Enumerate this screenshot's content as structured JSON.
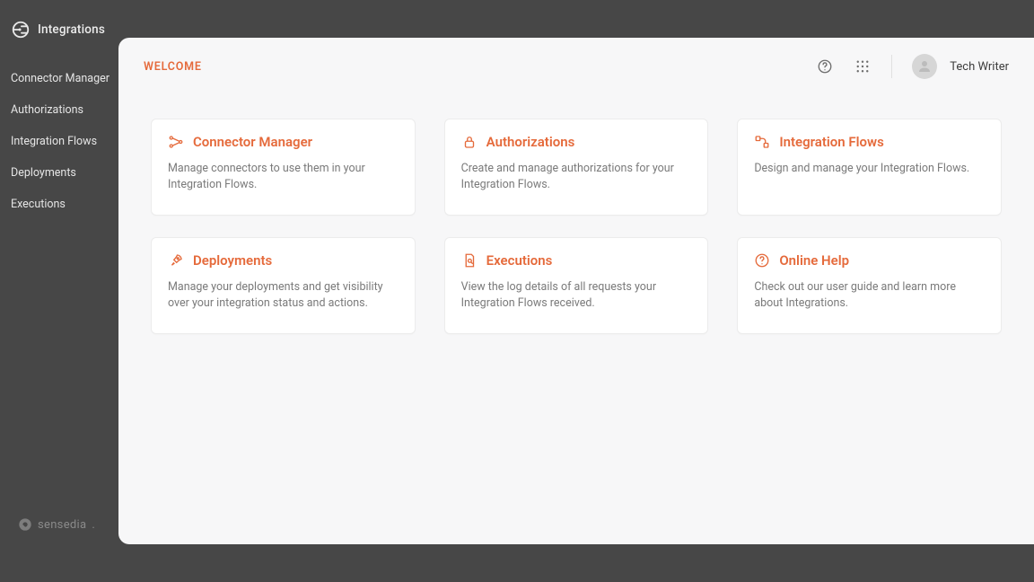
{
  "sidebar": {
    "brand": "Integrations",
    "items": [
      "Connector Manager",
      "Authorizations",
      "Integration Flows",
      "Deployments",
      "Executions"
    ],
    "footer_brand": "sensedia"
  },
  "header": {
    "title": "WELCOME",
    "user_name": "Tech Writer"
  },
  "cards": [
    {
      "title": "Connector Manager",
      "desc": "Manage connectors to use them in your Integration Flows."
    },
    {
      "title": "Authorizations",
      "desc": "Create and manage authorizations for your Integration Flows."
    },
    {
      "title": "Integration Flows",
      "desc": "Design and manage your Integration Flows."
    },
    {
      "title": "Deployments",
      "desc": "Manage your deployments and get visibility over your integration status and actions."
    },
    {
      "title": "Executions",
      "desc": "View the log details of all requests your Integration Flows received."
    },
    {
      "title": "Online Help",
      "desc": "Check out our user guide and learn more about Integrations."
    }
  ]
}
